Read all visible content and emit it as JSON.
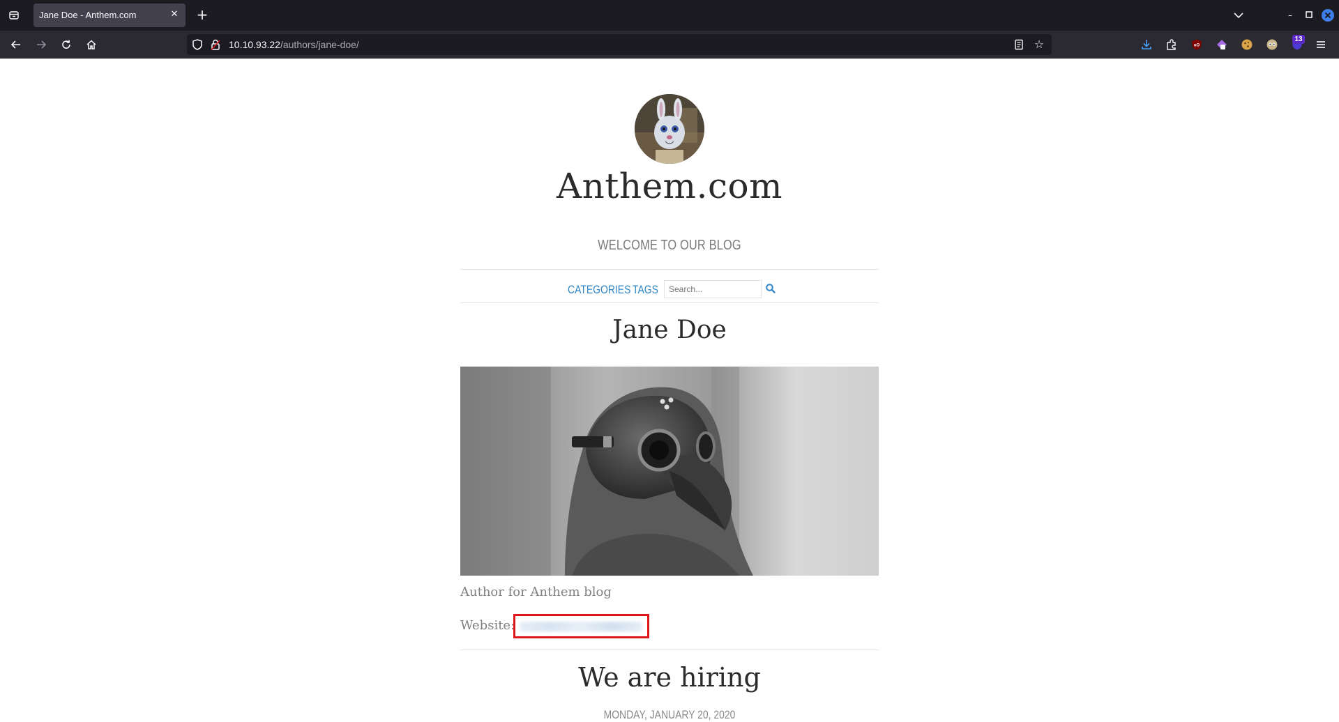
{
  "browser": {
    "tab_title": "Jane Doe - Anthem.com",
    "url_host": "10.10.93.22",
    "url_path": "/authors/jane-doe/",
    "extensions_badge": "13"
  },
  "site": {
    "title": "Anthem.com",
    "tagline": "WELCOME TO OUR BLOG",
    "menu": {
      "categories": "CATEGORIES",
      "tags": "TAGS",
      "search_placeholder": "Search..."
    }
  },
  "author": {
    "name": "Jane Doe",
    "bio": "Author for Anthem blog",
    "website_label": "Website:"
  },
  "post": {
    "title": "We are hiring",
    "date": "MONDAY, JANUARY 20, 2020"
  },
  "colors": {
    "link": "#2e86c8",
    "highlight_box": "#e0161d",
    "chrome_dark": "#1c1b22"
  }
}
